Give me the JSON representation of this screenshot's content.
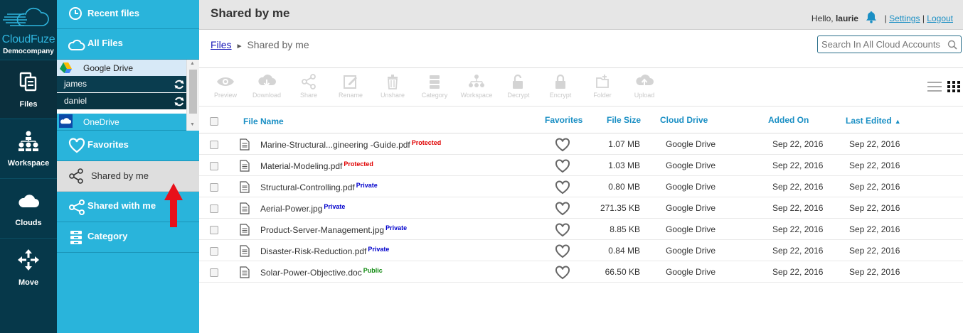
{
  "brand": {
    "name": "CloudFuze",
    "company": "Democompany"
  },
  "rail": [
    {
      "label": "Files",
      "icon": "files-icon"
    },
    {
      "label": "Workspace",
      "icon": "workspace-icon"
    },
    {
      "label": "Clouds",
      "icon": "cloud-icon"
    },
    {
      "label": "Move",
      "icon": "move-icon"
    }
  ],
  "sidebar": {
    "recent": "Recent files",
    "all_files": "All Files",
    "drives": {
      "google": "Google Drive",
      "accounts": [
        "james",
        "daniel"
      ],
      "onedrive": "OneDrive"
    },
    "favorites": "Favorites",
    "shared_by_me": "Shared by me",
    "shared_with_me": "Shared with me",
    "category": "Category"
  },
  "header": {
    "title": "Shared by me",
    "greeting": "Hello,",
    "username": "laurie",
    "settings": "Settings",
    "logout": "Logout",
    "sep": "|"
  },
  "breadcrumb": {
    "root": "Files",
    "current": "Shared by me"
  },
  "search": {
    "placeholder": "Search In All Cloud Accounts"
  },
  "toolbar": [
    "Preview",
    "Download",
    "Share",
    "Rename",
    "Unshare",
    "Category",
    "Workspace",
    "Decrypt",
    "Encrypt",
    "Folder",
    "Upload"
  ],
  "table": {
    "headers": {
      "name": "File Name",
      "favorites": "Favorites",
      "size": "File Size",
      "drive": "Cloud Drive",
      "added": "Added On",
      "edited": "Last Edited",
      "sort_indicator": "▲"
    },
    "rows": [
      {
        "name": "Marine-Structural...gineering -Guide.pdf",
        "tag": "Protected",
        "size": "1.07 MB",
        "drive": "Google Drive",
        "added": "Sep 22, 2016",
        "edited": "Sep 22, 2016"
      },
      {
        "name": "Material-Modeling.pdf",
        "tag": "Protected",
        "size": "1.03 MB",
        "drive": "Google Drive",
        "added": "Sep 22, 2016",
        "edited": "Sep 22, 2016"
      },
      {
        "name": "Structural-Controlling.pdf",
        "tag": "Private",
        "size": "0.80 MB",
        "drive": "Google Drive",
        "added": "Sep 22, 2016",
        "edited": "Sep 22, 2016"
      },
      {
        "name": "Aerial-Power.jpg",
        "tag": "Private",
        "size": "271.35 KB",
        "drive": "Google Drive",
        "added": "Sep 22, 2016",
        "edited": "Sep 22, 2016"
      },
      {
        "name": "Product-Server-Management.jpg",
        "tag": "Private",
        "size": "8.85 KB",
        "drive": "Google Drive",
        "added": "Sep 22, 2016",
        "edited": "Sep 22, 2016"
      },
      {
        "name": "Disaster-Risk-Reduction.pdf",
        "tag": "Private",
        "size": "0.84 MB",
        "drive": "Google Drive",
        "added": "Sep 22, 2016",
        "edited": "Sep 22, 2016"
      },
      {
        "name": "Solar-Power-Objective.doc",
        "tag": "Public",
        "size": "66.50 KB",
        "drive": "Google Drive",
        "added": "Sep 22, 2016",
        "edited": "Sep 22, 2016"
      }
    ]
  },
  "colors": {
    "rail": "#06384a",
    "sidebar": "#29b4db",
    "accent": "#1a8fc4",
    "tag_protected": "#e00000",
    "tag_private": "#0000cc",
    "tag_public": "#108a10",
    "annotation_arrow": "#e8101a"
  }
}
